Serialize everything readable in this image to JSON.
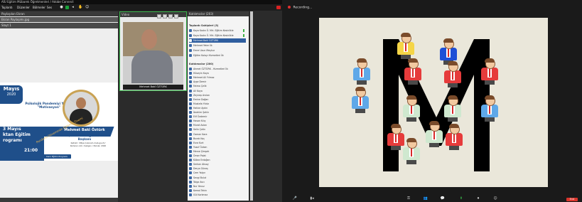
{
  "left_app": {
    "window_title": "AİU Eğitim Mübarek Öğretmenleri / Adobe Connect",
    "menu": [
      "Toplantı",
      "Düzenler",
      "Bölmeler",
      "Ses"
    ],
    "share_pod": {
      "title": "Paylaşılan Ekran",
      "toolbar_label": "Slayt 1",
      "file_name": "Ekran Paylaşımı.jpg"
    },
    "poster": {
      "month": "Mayıs",
      "year": "2020",
      "topic_line1": "Psikolojik Pandemiyi Yenme",
      "topic_line2": "\"Motivasyon\"",
      "speaker_name": "Mehmet Bakî Öztürk",
      "speaker_title": "Ar-Ge, Kalite ve Eğitime Daire Başkanı",
      "block_date": "3 Mayıs",
      "block_line2": "ktan Eğitim",
      "block_line3": "rogramı",
      "time": "21:00",
      "diagonal_text": "Pandemi Döneminde Eğitimin Önemi",
      "url_line1": "Katılım: https://okulum.meb.gov.tr/",
      "url_line2": "Kullanıcı Adı: mebgov / Parola: 2020",
      "bottom_label": "Canlı Eğitim Programı"
    },
    "video_pod": {
      "title": "Video",
      "name_tag": "Mehmet Bakî ÖZTÜRK"
    },
    "attendees_pod": {
      "title": "Katılımcılar",
      "count": "(203)",
      "hosts_header": "Toplantı Sahipleri (3)",
      "hosts": [
        "Kaya Kadın Ö. Mrt. Eğitim Kesinlikle",
        "Kaya Kadın Ö. Mrt. Eğitim Kesinlikle",
        "Mehmet Bakî ÖZTÜRK"
      ],
      "presenters": [
        "Mehmet Yeter İlk",
        "Emre Uzun Meşhur",
        "Eğitim Kolayı Hizmetleri İlk"
      ],
      "participants_header": "Katılımcılar (200)",
      "participants": [
        "Ahmet ÖZTÜRK - Hizmetleri İlk",
        "Hüseyin Kaya",
        "Mehmet Ali Yılmaz",
        "Ayşe Demir",
        "Fatma Çelik",
        "Ali Kaya",
        "Zeynep Arslan",
        "Emine Doğan",
        "Mustafa Yıldız",
        "Hatice Aydın",
        "İbrahim Şahin",
        "Elif Özdemir",
        "Hasan Kılıç",
        "Murat Aslan",
        "Selin Çetin",
        "Osman Kara",
        "Burak Koç",
        "Esra Kurt",
        "Yusuf Özkan",
        "Merve Şimşek",
        "Ömer Polat",
        "Kübra Erdoğan",
        "Serkan Aksoy",
        "Derya Güneş",
        "Cem Yalçın",
        "Sevgi Bulut",
        "Tolga Avcı",
        "Nur Yavuz",
        "Kemal Tekin",
        "Gül Korkmaz",
        "Erkan Ateş",
        "Seda Karaca"
      ]
    }
  },
  "right_app": {
    "recording_label": "Recording...",
    "toolbar": [
      "Mute",
      "Video",
      "Security",
      "Participants",
      "Chat",
      "Share",
      "Record",
      "Reactions"
    ],
    "leave_label": "End",
    "slide_letter": "M",
    "colors": {
      "brand_blue": "#1f4f8a",
      "gold": "#c9a253",
      "active_green": "#38b54a",
      "record_red": "#e03030"
    }
  }
}
